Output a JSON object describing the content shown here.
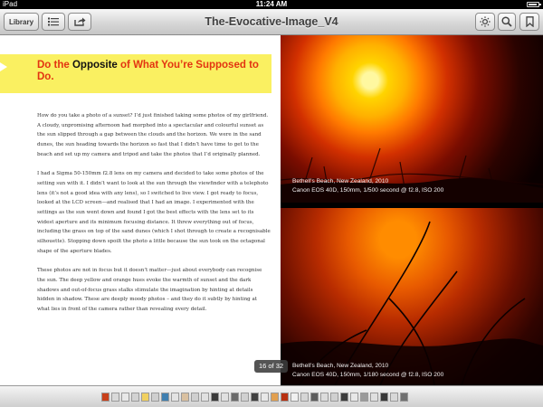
{
  "status_bar": {
    "carrier": "iPad",
    "time": "11:24 AM",
    "battery_level": 0.85
  },
  "toolbar": {
    "library_label": "Library",
    "title": "The-Evocative-Image_V4",
    "icons": [
      "list-icon",
      "share-icon",
      "brightness-icon",
      "search-icon",
      "bookmark-icon"
    ]
  },
  "article": {
    "headline_part1": "Do the ",
    "headline_emphasis": "Opposite",
    "headline_part2": " of What You’re Supposed to Do.",
    "paragraphs": [
      "How do you take a photo of a sunset? I’d just finished taking some photos of my girlfriend. A cloudy, unpromising afternoon had morphed into a spectacular and colourful sunset as the sun slipped through a gap between the clouds and the horizon. We were in the sand dunes, the sun heading towards the horizon so fast that I didn’t have time to get to the beach and set up my camera and tripod and take the photos that I’d originally planned.",
      "I had a Sigma 50-150mm f2.8 lens on my camera and decided to take some photos of the setting sun with it. I didn’t want to look at the sun through the viewfinder with a telephoto lens (it’s not a good idea with any lens), so I switched to live view. I got ready to focus, looked at the LCD screen—and realised that I had an image. I experimented with the settings as the sun went down and found I got the best effects with the lens set to its widest aperture and its minimum focusing distance. It threw everything out of focus, including the grass on top of the sand dunes (which I shot through to create a recognisable silhouette). Stopping down spoilt the photo a little because the sun took on the octagonal shape of the aperture blades.",
      "These photos are not in focus but it doesn’t matter—just about everybody can recognise the sun. The deep yellow and orange hues evoke the warmth of sunset and the dark shadows and out-of-focus grass stalks stimulate the imagination by hinting at details hidden in shadow. These are deeply moody photos – and they do it subtly by hinting at what lies in front of the camera rather than revealing every detail."
    ]
  },
  "photos": [
    {
      "caption_line1": "Bethell’s Beach, New Zealand, 2010",
      "caption_line2": "Canon EOS 40D, 150mm, 1/500 second @ f2.8, ISO 200"
    },
    {
      "caption_line1": "Bethell’s Beach, New Zealand, 2010",
      "caption_line2": "Canon EOS 40D, 150mm, 1/180 second @ f2.8, ISO 200"
    }
  ],
  "page_indicator": "16 of 32",
  "colors": {
    "banner": "#faf061",
    "headline": "#e33411"
  },
  "scrubber": {
    "thumb_colors": [
      "#c8401a",
      "#d9d9d9",
      "#e8e8e8",
      "#d2d2d2",
      "#f0d060",
      "#cfcfcf",
      "#3f7fb0",
      "#e3e3e3",
      "#d9c0a0",
      "#cfcfcf",
      "#e0e0e0",
      "#3a3a3a",
      "#e0e0e0",
      "#6a6a6a",
      "#d0d0d0",
      "#404040",
      "#e8e8e8",
      "#e2a050",
      "#b83010",
      "#f0f0f0",
      "#d6d6d6",
      "#5c5c5c",
      "#dcdcdc",
      "#d0d0d0",
      "#3b3b3b",
      "#e8e8e8",
      "#9a9a9a",
      "#e0e0e0",
      "#383838",
      "#d8d8d8",
      "#707070"
    ]
  }
}
